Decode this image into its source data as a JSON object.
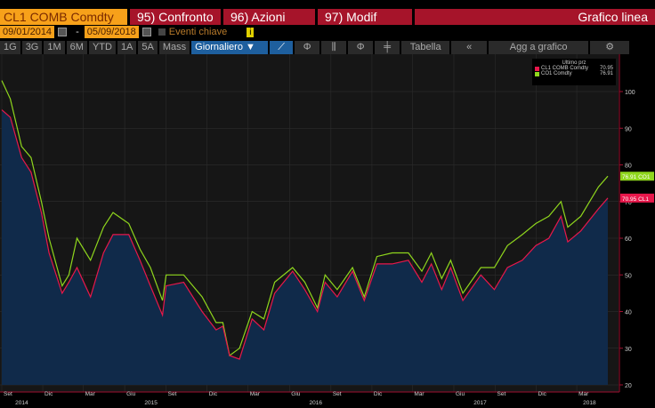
{
  "header": {
    "ticker": "CL1 COMB Comdty",
    "compare": "95) Confronto",
    "actions": "96) Azioni",
    "modify": "97) Modif",
    "chart_type": "Grafico linea"
  },
  "dates": {
    "start": "09/01/2014",
    "sep": "-",
    "end": "05/09/2018",
    "events": "Eventi chiave",
    "info": "i"
  },
  "toolbar": {
    "periods": [
      "1G",
      "3G",
      "1M",
      "6M",
      "YTD",
      "1A",
      "5A",
      "Mass"
    ],
    "frequency": "Giornaliero ▼",
    "table": "Tabella",
    "collapse": "«",
    "add": "Agg a grafico",
    "settings": "⚙"
  },
  "colors": {
    "cl": "#e8174b",
    "co": "#8fd61d",
    "fill": "#102a4a"
  },
  "chart_data": {
    "type": "line",
    "legend_title": "Ultimo prz",
    "ylim": [
      20,
      104
    ],
    "yticks": [
      20,
      30,
      40,
      50,
      60,
      70,
      80,
      90,
      100
    ],
    "xticks": [
      {
        "d": "2014-09-01",
        "l": "Set"
      },
      {
        "d": "2014-12-01",
        "l": "Dic"
      },
      {
        "d": "2015-03-01",
        "l": "Mar"
      },
      {
        "d": "2015-06-01",
        "l": "Giu"
      },
      {
        "d": "2015-09-01",
        "l": "Set"
      },
      {
        "d": "2015-12-01",
        "l": "Dic"
      },
      {
        "d": "2016-03-01",
        "l": "Mar"
      },
      {
        "d": "2016-06-01",
        "l": "Giu"
      },
      {
        "d": "2016-09-01",
        "l": "Set"
      },
      {
        "d": "2016-12-01",
        "l": "Dic"
      },
      {
        "d": "2017-03-01",
        "l": "Mar"
      },
      {
        "d": "2017-06-01",
        "l": "Giu"
      },
      {
        "d": "2017-09-01",
        "l": "Set"
      },
      {
        "d": "2017-12-01",
        "l": "Dic"
      },
      {
        "d": "2018-03-01",
        "l": "Mar"
      }
    ],
    "years": [
      {
        "d": "2014-10-01",
        "l": "2014"
      },
      {
        "d": "2015-07-15",
        "l": "2015"
      },
      {
        "d": "2016-07-15",
        "l": "2016"
      },
      {
        "d": "2017-07-15",
        "l": "2017"
      },
      {
        "d": "2018-03-15",
        "l": "2018"
      }
    ],
    "dates": [
      "2014-09-01",
      "2014-09-20",
      "2014-10-15",
      "2014-11-05",
      "2014-11-28",
      "2014-12-15",
      "2015-01-13",
      "2015-01-28",
      "2015-02-15",
      "2015-03-17",
      "2015-04-15",
      "2015-05-06",
      "2015-06-10",
      "2015-07-05",
      "2015-07-28",
      "2015-08-24",
      "2015-09-01",
      "2015-10-10",
      "2015-11-20",
      "2015-12-21",
      "2016-01-05",
      "2016-01-20",
      "2016-02-11",
      "2016-03-10",
      "2016-04-05",
      "2016-04-29",
      "2016-06-08",
      "2016-07-05",
      "2016-08-02",
      "2016-08-19",
      "2016-09-15",
      "2016-10-19",
      "2016-11-14",
      "2016-12-12",
      "2017-01-15",
      "2017-02-20",
      "2017-03-22",
      "2017-04-12",
      "2017-05-05",
      "2017-05-25",
      "2017-06-21",
      "2017-07-31",
      "2017-08-30",
      "2017-09-28",
      "2017-10-31",
      "2017-11-30",
      "2017-12-29",
      "2018-01-25",
      "2018-02-09",
      "2018-03-10",
      "2018-04-18",
      "2018-05-09"
    ],
    "series": [
      {
        "name": "CL1 COMB Comdty",
        "last": "70.95",
        "tag": "70.95 CL1",
        "values": [
          95,
          93,
          82,
          78,
          67,
          56,
          45,
          48,
          52,
          44,
          56,
          61,
          61,
          54,
          47,
          39,
          47,
          48,
          40,
          35,
          36,
          28,
          27,
          38,
          35,
          45,
          51,
          46,
          40,
          48,
          44,
          51,
          43,
          53,
          53,
          54,
          48,
          53,
          46,
          52,
          43,
          50,
          46,
          52,
          54,
          58,
          60,
          66,
          59,
          62,
          68,
          70.95
        ]
      },
      {
        "name": "CO1 Comdty",
        "last": "76.91",
        "tag": "76.91 CO1",
        "values": [
          103,
          98,
          85,
          82,
          70,
          60,
          47,
          50,
          60,
          54,
          63,
          67,
          64,
          57,
          52,
          43,
          50,
          50,
          44,
          37,
          37,
          28,
          30,
          40,
          38,
          48,
          52,
          48,
          41,
          50,
          46,
          52,
          44,
          55,
          56,
          56,
          51,
          56,
          49,
          54,
          45,
          52,
          52,
          58,
          61,
          64,
          66,
          70,
          63,
          66,
          74,
          76.91
        ]
      }
    ]
  }
}
